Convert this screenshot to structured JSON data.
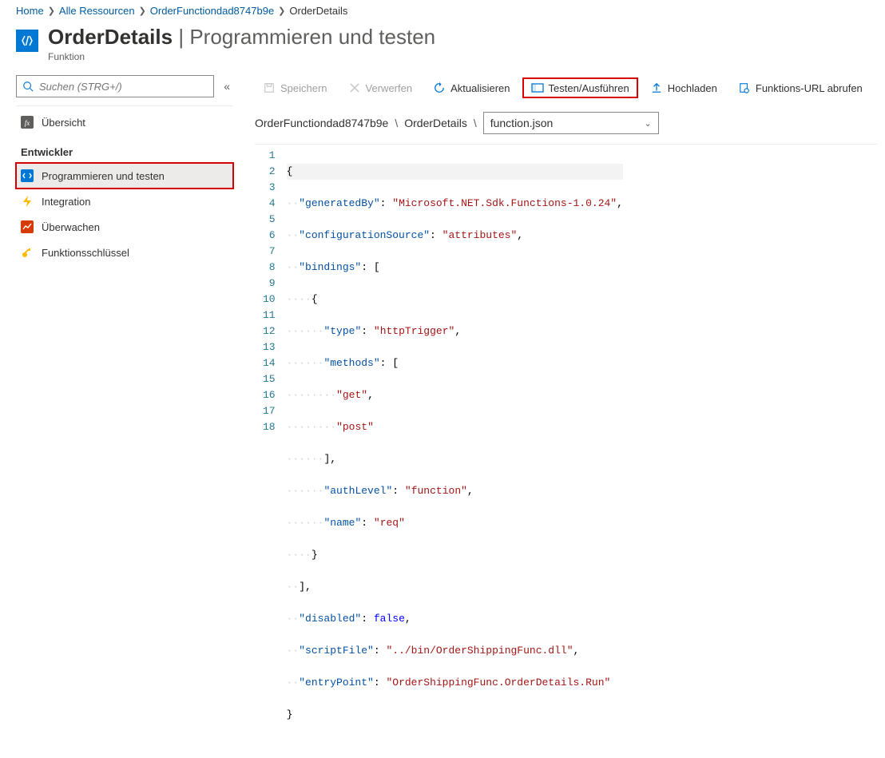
{
  "breadcrumb": {
    "home": "Home",
    "all": "Alle Ressourcen",
    "funcapp": "OrderFunctiondad8747b9e",
    "current": "OrderDetails"
  },
  "title": {
    "name": "OrderDetails",
    "sep": "|",
    "section": "Programmieren und testen",
    "subtitle": "Funktion"
  },
  "search": {
    "placeholder": "Suchen (STRG+/)"
  },
  "sidebar": {
    "overview": "Übersicht",
    "groupDev": "Entwickler",
    "codeTest": "Programmieren und testen",
    "integration": "Integration",
    "monitor": "Überwachen",
    "keys": "Funktionsschlüssel"
  },
  "toolbar": {
    "save": "Speichern",
    "discard": "Verwerfen",
    "refresh": "Aktualisieren",
    "testRun": "Testen/Ausführen",
    "upload": "Hochladen",
    "getUrl": "Funktions-URL abrufen"
  },
  "path": {
    "app": "OrderFunctiondad8747b9e",
    "func": "OrderDetails",
    "file": "function.json"
  },
  "code": {
    "1": "{",
    "2": {
      "k": "\"generatedBy\"",
      "v": "\"Microsoft.NET.Sdk.Functions-1.0.24\"",
      "t": ","
    },
    "3": {
      "k": "\"configurationSource\"",
      "v": "\"attributes\"",
      "t": ","
    },
    "4": {
      "k": "\"bindings\"",
      "p": ": ["
    },
    "5": "{",
    "6": {
      "k": "\"type\"",
      "v": "\"httpTrigger\"",
      "t": ","
    },
    "7": {
      "k": "\"methods\"",
      "p": ": ["
    },
    "8": {
      "v": "\"get\"",
      "t": ","
    },
    "9": {
      "v": "\"post\""
    },
    "10": "],",
    "11": {
      "k": "\"authLevel\"",
      "v": "\"function\"",
      "t": ","
    },
    "12": {
      "k": "\"name\"",
      "v": "\"req\""
    },
    "13": "}",
    "14": "],",
    "15": {
      "k": "\"disabled\"",
      "b": "false",
      "t": ","
    },
    "16": {
      "k": "\"scriptFile\"",
      "v": "\"../bin/OrderShippingFunc.dll\"",
      "t": ","
    },
    "17": {
      "k": "\"entryPoint\"",
      "v": "\"OrderShippingFunc.OrderDetails.Run\""
    },
    "18": "}"
  }
}
